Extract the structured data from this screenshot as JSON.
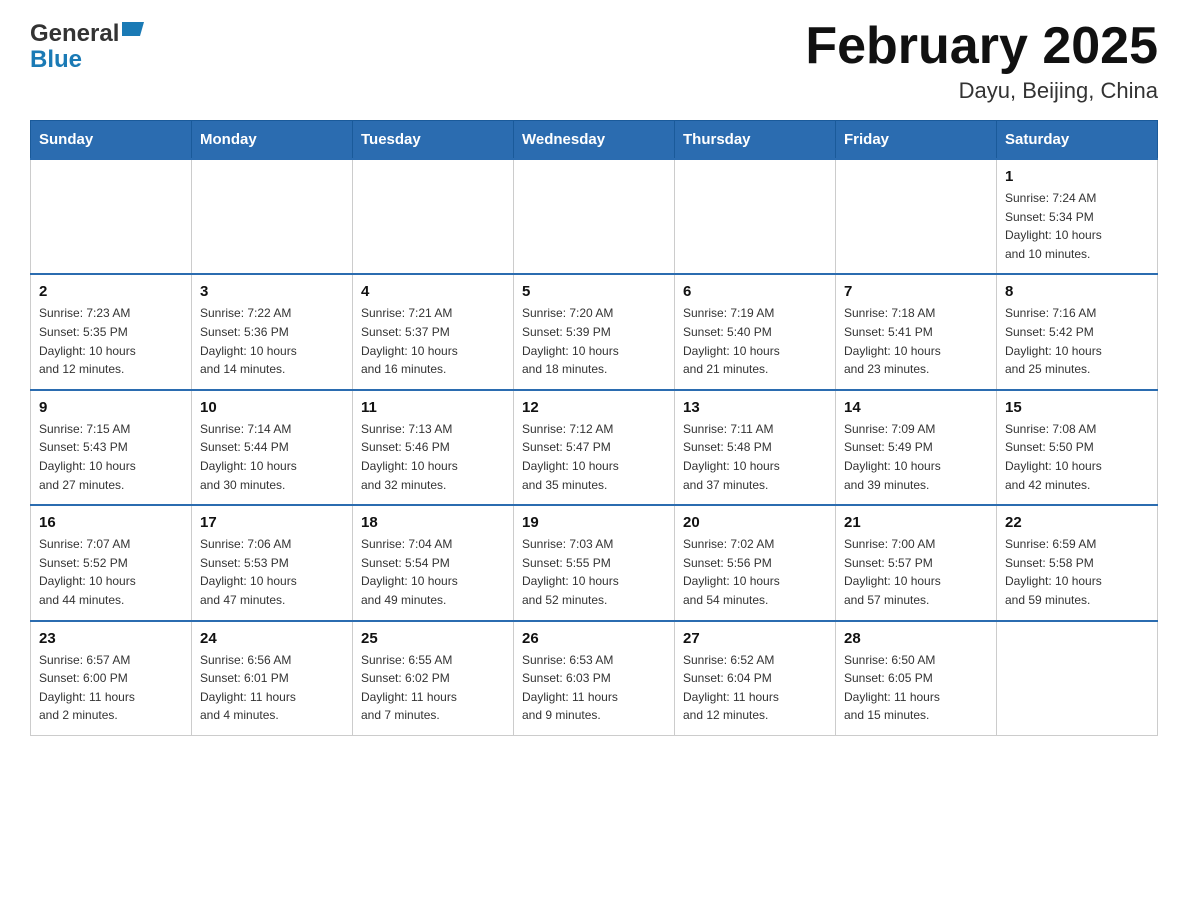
{
  "header": {
    "title": "February 2025",
    "subtitle": "Dayu, Beijing, China",
    "logo_general": "General",
    "logo_blue": "Blue"
  },
  "weekdays": [
    "Sunday",
    "Monday",
    "Tuesday",
    "Wednesday",
    "Thursday",
    "Friday",
    "Saturday"
  ],
  "weeks": [
    {
      "days": [
        {
          "date": "",
          "info": ""
        },
        {
          "date": "",
          "info": ""
        },
        {
          "date": "",
          "info": ""
        },
        {
          "date": "",
          "info": ""
        },
        {
          "date": "",
          "info": ""
        },
        {
          "date": "",
          "info": ""
        },
        {
          "date": "1",
          "info": "Sunrise: 7:24 AM\nSunset: 5:34 PM\nDaylight: 10 hours\nand 10 minutes."
        }
      ]
    },
    {
      "days": [
        {
          "date": "2",
          "info": "Sunrise: 7:23 AM\nSunset: 5:35 PM\nDaylight: 10 hours\nand 12 minutes."
        },
        {
          "date": "3",
          "info": "Sunrise: 7:22 AM\nSunset: 5:36 PM\nDaylight: 10 hours\nand 14 minutes."
        },
        {
          "date": "4",
          "info": "Sunrise: 7:21 AM\nSunset: 5:37 PM\nDaylight: 10 hours\nand 16 minutes."
        },
        {
          "date": "5",
          "info": "Sunrise: 7:20 AM\nSunset: 5:39 PM\nDaylight: 10 hours\nand 18 minutes."
        },
        {
          "date": "6",
          "info": "Sunrise: 7:19 AM\nSunset: 5:40 PM\nDaylight: 10 hours\nand 21 minutes."
        },
        {
          "date": "7",
          "info": "Sunrise: 7:18 AM\nSunset: 5:41 PM\nDaylight: 10 hours\nand 23 minutes."
        },
        {
          "date": "8",
          "info": "Sunrise: 7:16 AM\nSunset: 5:42 PM\nDaylight: 10 hours\nand 25 minutes."
        }
      ]
    },
    {
      "days": [
        {
          "date": "9",
          "info": "Sunrise: 7:15 AM\nSunset: 5:43 PM\nDaylight: 10 hours\nand 27 minutes."
        },
        {
          "date": "10",
          "info": "Sunrise: 7:14 AM\nSunset: 5:44 PM\nDaylight: 10 hours\nand 30 minutes."
        },
        {
          "date": "11",
          "info": "Sunrise: 7:13 AM\nSunset: 5:46 PM\nDaylight: 10 hours\nand 32 minutes."
        },
        {
          "date": "12",
          "info": "Sunrise: 7:12 AM\nSunset: 5:47 PM\nDaylight: 10 hours\nand 35 minutes."
        },
        {
          "date": "13",
          "info": "Sunrise: 7:11 AM\nSunset: 5:48 PM\nDaylight: 10 hours\nand 37 minutes."
        },
        {
          "date": "14",
          "info": "Sunrise: 7:09 AM\nSunset: 5:49 PM\nDaylight: 10 hours\nand 39 minutes."
        },
        {
          "date": "15",
          "info": "Sunrise: 7:08 AM\nSunset: 5:50 PM\nDaylight: 10 hours\nand 42 minutes."
        }
      ]
    },
    {
      "days": [
        {
          "date": "16",
          "info": "Sunrise: 7:07 AM\nSunset: 5:52 PM\nDaylight: 10 hours\nand 44 minutes."
        },
        {
          "date": "17",
          "info": "Sunrise: 7:06 AM\nSunset: 5:53 PM\nDaylight: 10 hours\nand 47 minutes."
        },
        {
          "date": "18",
          "info": "Sunrise: 7:04 AM\nSunset: 5:54 PM\nDaylight: 10 hours\nand 49 minutes."
        },
        {
          "date": "19",
          "info": "Sunrise: 7:03 AM\nSunset: 5:55 PM\nDaylight: 10 hours\nand 52 minutes."
        },
        {
          "date": "20",
          "info": "Sunrise: 7:02 AM\nSunset: 5:56 PM\nDaylight: 10 hours\nand 54 minutes."
        },
        {
          "date": "21",
          "info": "Sunrise: 7:00 AM\nSunset: 5:57 PM\nDaylight: 10 hours\nand 57 minutes."
        },
        {
          "date": "22",
          "info": "Sunrise: 6:59 AM\nSunset: 5:58 PM\nDaylight: 10 hours\nand 59 minutes."
        }
      ]
    },
    {
      "days": [
        {
          "date": "23",
          "info": "Sunrise: 6:57 AM\nSunset: 6:00 PM\nDaylight: 11 hours\nand 2 minutes."
        },
        {
          "date": "24",
          "info": "Sunrise: 6:56 AM\nSunset: 6:01 PM\nDaylight: 11 hours\nand 4 minutes."
        },
        {
          "date": "25",
          "info": "Sunrise: 6:55 AM\nSunset: 6:02 PM\nDaylight: 11 hours\nand 7 minutes."
        },
        {
          "date": "26",
          "info": "Sunrise: 6:53 AM\nSunset: 6:03 PM\nDaylight: 11 hours\nand 9 minutes."
        },
        {
          "date": "27",
          "info": "Sunrise: 6:52 AM\nSunset: 6:04 PM\nDaylight: 11 hours\nand 12 minutes."
        },
        {
          "date": "28",
          "info": "Sunrise: 6:50 AM\nSunset: 6:05 PM\nDaylight: 11 hours\nand 15 minutes."
        },
        {
          "date": "",
          "info": ""
        }
      ]
    }
  ]
}
